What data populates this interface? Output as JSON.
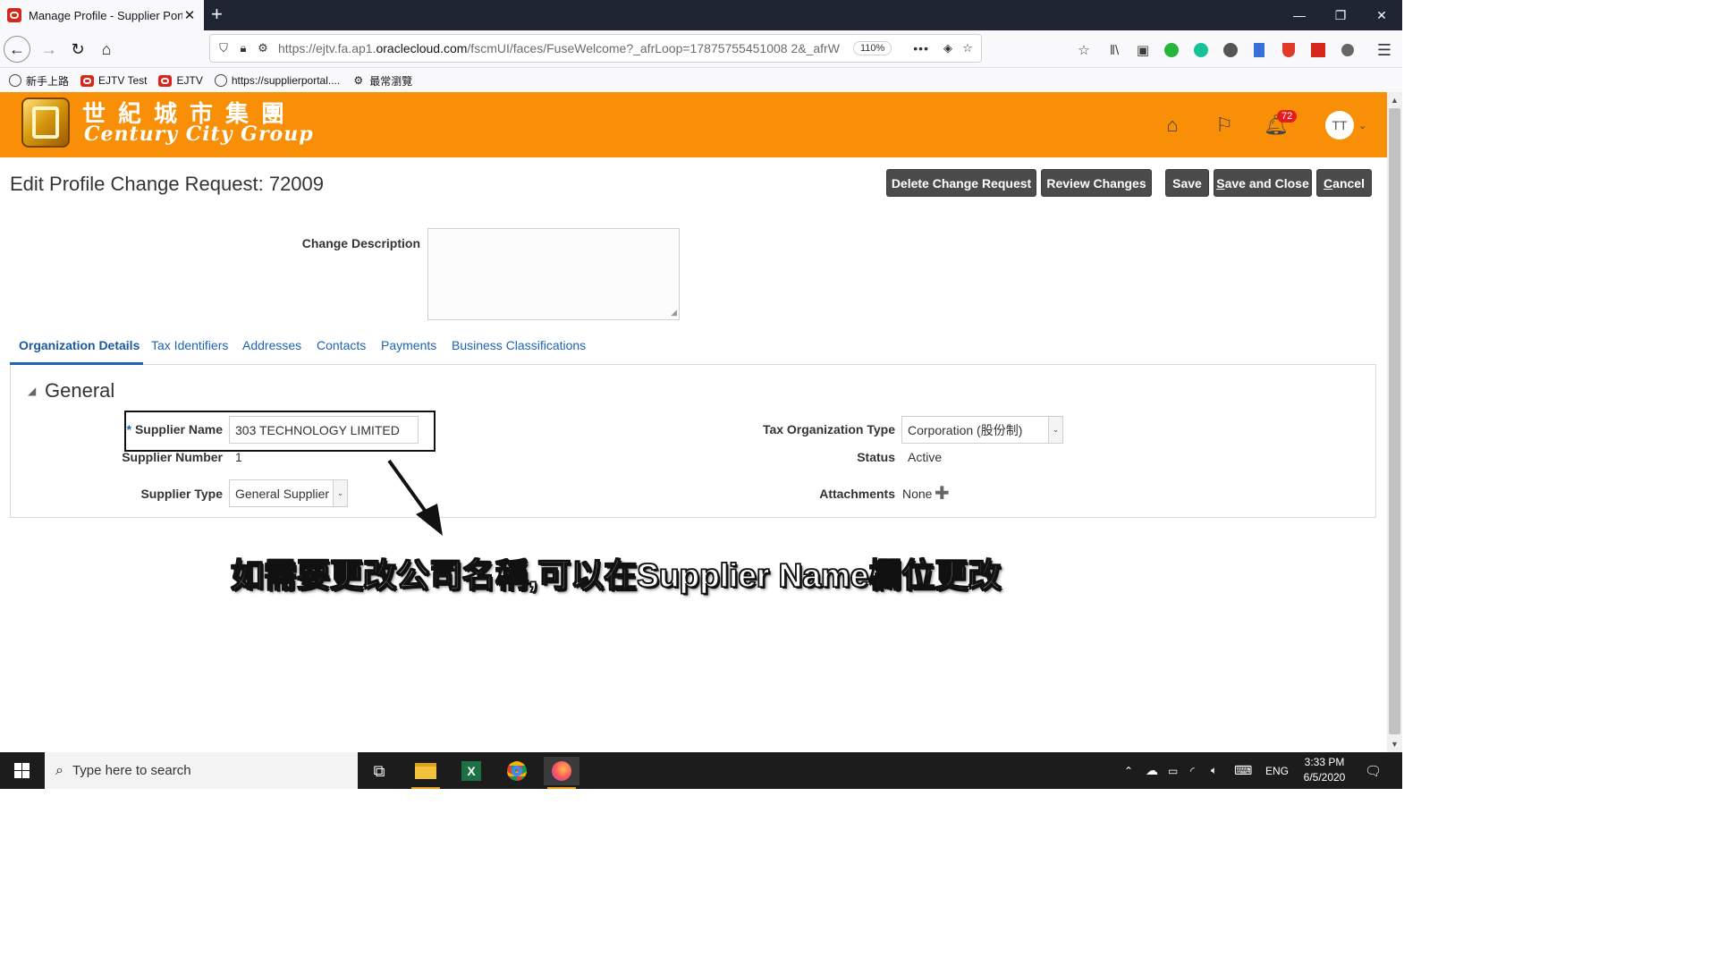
{
  "browser": {
    "tab_title": "Manage Profile - Supplier Porta",
    "url_prefix": "https://ejtv.fa.ap1.",
    "url_host": "oraclecloud.com",
    "url_rest": "/fscmUI/faces/FuseWelcome?_afrLoop=17875755451008 2&_afrW",
    "zoom": "110%",
    "bookmarks": [
      "新手上路",
      "EJTV Test",
      "EJTV",
      "https://supplierportal....",
      "最常瀏覽"
    ]
  },
  "header": {
    "logo_cn": "世紀城市集團",
    "logo_en": "Century City Group",
    "notification_count": "72",
    "user_initials": "TT"
  },
  "page": {
    "title": "Edit Profile Change Request: 72009",
    "buttons": {
      "delete": "Delete Change Request",
      "review": "Review Changes",
      "save": "Save",
      "save_close_first": "S",
      "save_close_rest": "ave and Close",
      "cancel_first": "C",
      "cancel_rest": "ancel"
    },
    "change_description_label": "Change Description",
    "change_description_value": "",
    "tabs": [
      "Organization Details",
      "Tax Identifiers",
      "Addresses",
      "Contacts",
      "Payments",
      "Business Classifications"
    ],
    "active_tab": "Organization Details",
    "section_title": "General",
    "fields": {
      "supplier_name_label": "Supplier Name",
      "supplier_name_value": "303 TECHNOLOGY LIMITED",
      "supplier_number_label": "Supplier Number",
      "supplier_number_value": "1",
      "supplier_type_label": "Supplier Type",
      "supplier_type_value": "General Supplier",
      "tax_org_type_label": "Tax Organization Type",
      "tax_org_type_value": "Corporation (股份制)",
      "status_label": "Status",
      "status_value": "Active",
      "attachments_label": "Attachments",
      "attachments_value": "None"
    },
    "required_marker": "*",
    "annotation": "如需要更改公司名稱,可以在Supplier Name欄位更改"
  },
  "taskbar": {
    "search_placeholder": "Type here to search",
    "language": "ENG",
    "time": "3:33 PM",
    "date": "6/5/2020"
  },
  "colors": {
    "banner": "#f88f06",
    "button": "#4b4b4b",
    "link": "#1d64b4"
  }
}
